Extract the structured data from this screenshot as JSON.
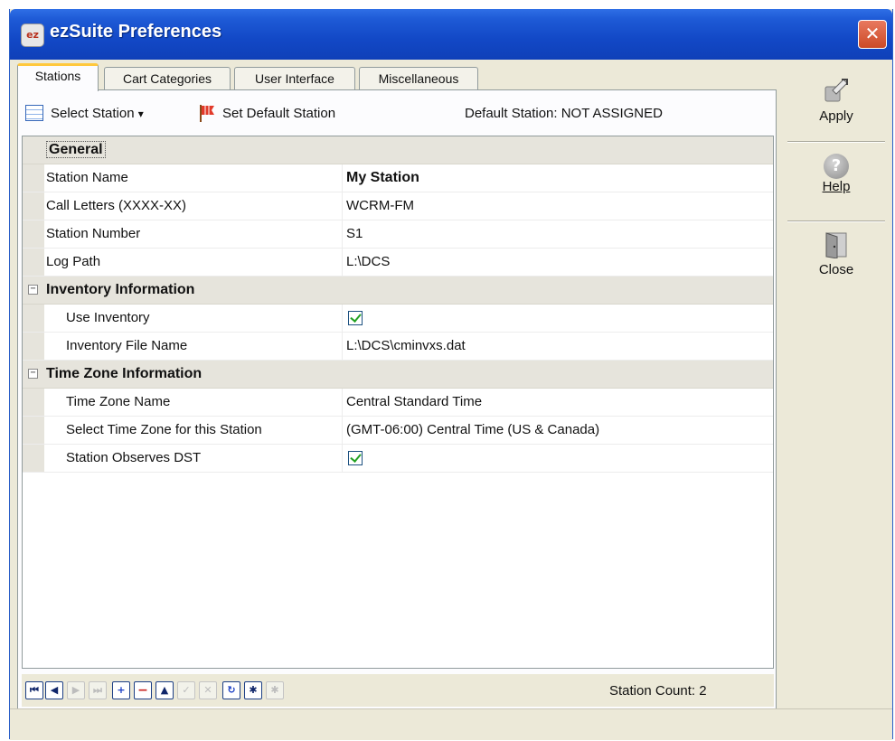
{
  "window": {
    "title": "ezSuite Preferences",
    "app_icon_text": "ez",
    "close_glyph": "✕"
  },
  "tabs": [
    {
      "label": "Stations",
      "active": true
    },
    {
      "label": "Cart Categories",
      "active": false
    },
    {
      "label": "User Interface",
      "active": false
    },
    {
      "label": "Miscellaneous",
      "active": false
    }
  ],
  "toolbar": {
    "select_station": "Select Station",
    "dropdown_glyph": "▾",
    "set_default": "Set Default Station",
    "default_station_status": "Default Station: NOT ASSIGNED"
  },
  "grid": {
    "general": {
      "title": "General",
      "rows": [
        {
          "label": "Station Name",
          "value": "My Station"
        },
        {
          "label": "Call Letters (XXXX-XX)",
          "value": "WCRM-FM"
        },
        {
          "label": "Station Number",
          "value": "S1"
        },
        {
          "label": "Log Path",
          "value": "L:\\DCS"
        }
      ]
    },
    "inventory": {
      "title": "Inventory Information",
      "expander": "−",
      "rows": [
        {
          "label": "Use Inventory",
          "checked": true
        },
        {
          "label": "Inventory File Name",
          "value": "L:\\DCS\\cminvxs.dat"
        }
      ]
    },
    "timezone": {
      "title": "Time Zone Information",
      "expander": "−",
      "rows": [
        {
          "label": "Time Zone Name",
          "value": "Central Standard Time"
        },
        {
          "label": "Select Time Zone for this Station",
          "value": "(GMT-06:00) Central Time (US & Canada)"
        },
        {
          "label": "Station Observes DST",
          "checked": true
        }
      ]
    }
  },
  "navigator": {
    "buttons": [
      {
        "name": "first-record-button",
        "glyph": "⏮",
        "enabled": true
      },
      {
        "name": "prev-record-button",
        "glyph": "◀",
        "enabled": true
      },
      {
        "name": "next-record-button",
        "glyph": "▶",
        "enabled": false
      },
      {
        "name": "last-record-button",
        "glyph": "⏭",
        "enabled": false
      },
      {
        "name": "add-record-button",
        "glyph": "+",
        "enabled": true
      },
      {
        "name": "delete-record-button",
        "glyph": "−",
        "enabled": true
      },
      {
        "name": "edit-record-button",
        "glyph": "▲",
        "enabled": true
      },
      {
        "name": "post-edit-button",
        "glyph": "✓",
        "enabled": false
      },
      {
        "name": "cancel-edit-button",
        "glyph": "✕",
        "enabled": false
      },
      {
        "name": "refresh-button",
        "glyph": "↻",
        "enabled": true
      },
      {
        "name": "filter-button",
        "glyph": "✱",
        "enabled": true
      },
      {
        "name": "clear-filter-button",
        "glyph": "✱",
        "enabled": false
      }
    ],
    "station_count": "Station Count: 2"
  },
  "side": {
    "apply": "Apply",
    "help": "Help",
    "help_glyph": "?",
    "close": "Close"
  }
}
